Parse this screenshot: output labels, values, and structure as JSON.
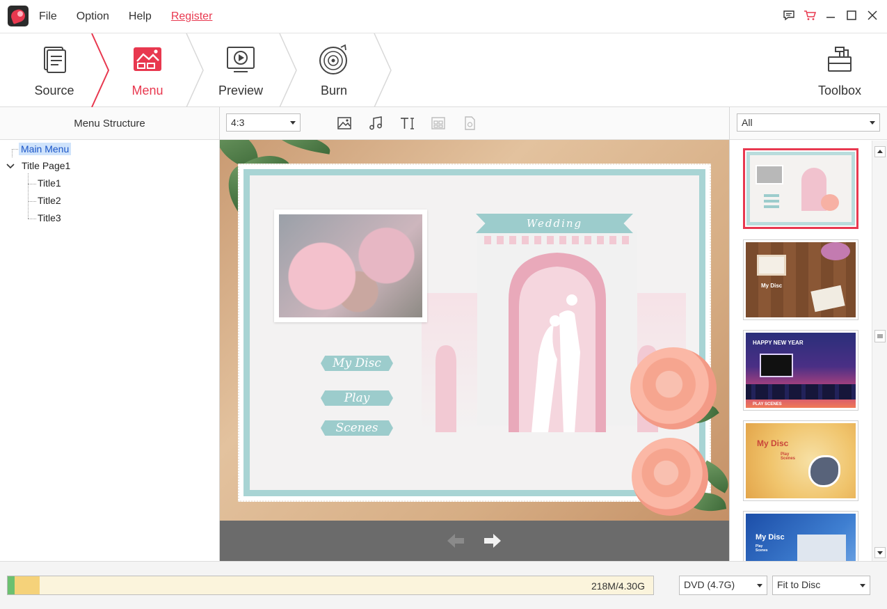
{
  "menubar": {
    "items": [
      "File",
      "Option",
      "Help"
    ],
    "register": "Register"
  },
  "window_controls": [
    "feedback-icon",
    "cart-icon",
    "minimize-icon",
    "maximize-icon",
    "close-icon"
  ],
  "steps": [
    {
      "label": "Source",
      "icon": "document-icon",
      "active": false
    },
    {
      "label": "Menu",
      "icon": "menu-image-icon",
      "active": true
    },
    {
      "label": "Preview",
      "icon": "play-screen-icon",
      "active": false
    },
    {
      "label": "Burn",
      "icon": "disc-icon",
      "active": false
    }
  ],
  "toolbox": {
    "label": "Toolbox",
    "icon": "toolbox-icon"
  },
  "left_panel": {
    "title": "Menu Structure",
    "tree": {
      "main": "Main Menu",
      "page": "Title Page1",
      "titles": [
        "Title1",
        "Title2",
        "Title3"
      ]
    }
  },
  "center_toolbar": {
    "aspect_ratio": "4:3",
    "tools": [
      "background-image-icon",
      "music-icon",
      "text-icon",
      "layout-icon",
      "thumbnail-icon"
    ]
  },
  "preview": {
    "banner": "Wedding",
    "buttons": [
      "My Disc",
      "Play",
      "Scenes"
    ]
  },
  "right_panel": {
    "filter": "All",
    "templates": [
      {
        "name": "wedding",
        "caption": ""
      },
      {
        "name": "wood",
        "caption": "My Disc"
      },
      {
        "name": "new-year",
        "caption": "HAPPY NEW YEAR",
        "sub": "PLAY    SCENES"
      },
      {
        "name": "autumn",
        "caption": "My Disc",
        "sub": "Play\nScenes"
      },
      {
        "name": "blue",
        "caption": "My Disc",
        "sub": "Play\nScenes"
      }
    ]
  },
  "bottom": {
    "capacity_text": "218M/4.30G",
    "capacity_used_fraction": 0.05,
    "disc_type": "DVD (4.7G)",
    "fit_mode": "Fit to Disc"
  },
  "colors": {
    "accent": "#e8384f",
    "frame_teal": "#a8d4d4",
    "selection_blue": "#cfe3fb"
  }
}
